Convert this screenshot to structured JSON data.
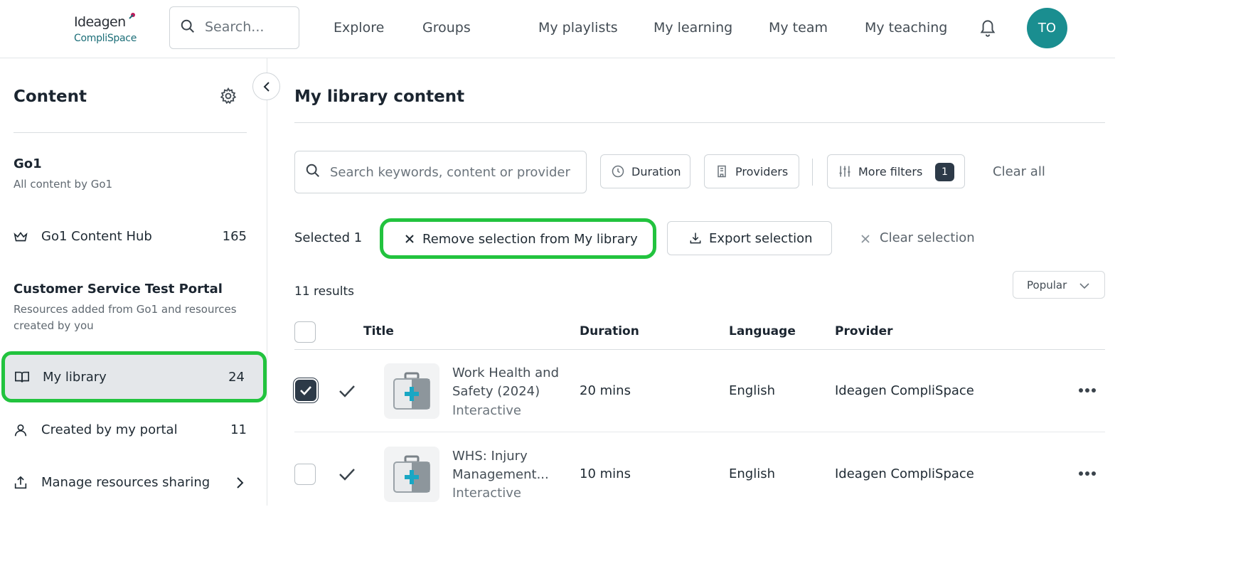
{
  "header": {
    "logo_line1": "Ideagen",
    "logo_line2": "CompliSpace",
    "search_placeholder": "Search...",
    "nav": [
      "Explore",
      "Groups",
      "My playlists",
      "My learning",
      "My team",
      "My teaching"
    ],
    "avatar_initials": "TO",
    "avatar_color": "#1a8e90"
  },
  "sidebar": {
    "title": "Content",
    "go1": {
      "title": "Go1",
      "subtitle": "All content by Go1"
    },
    "hub": {
      "label": "Go1 Content Hub",
      "count": "165"
    },
    "portal": {
      "title": "Customer Service Test Portal",
      "subtitle": "Resources added from Go1 and resources created by you"
    },
    "library": {
      "label": "My library",
      "count": "24"
    },
    "created": {
      "label": "Created by my portal",
      "count": "11"
    },
    "sharing": {
      "label": "Manage resources sharing"
    }
  },
  "main": {
    "title": "My library content",
    "search_placeholder": "Search keywords, content or provider",
    "filters": {
      "duration": "Duration",
      "providers": "Providers",
      "more": "More filters",
      "more_count": "1",
      "clear_all": "Clear all"
    },
    "selection": {
      "selected": "Selected 1",
      "remove": "Remove selection from My library",
      "export": "Export selection",
      "clear": "Clear selection"
    },
    "results": "11 results",
    "sort": "Popular",
    "columns": {
      "title": "Title",
      "duration": "Duration",
      "language": "Language",
      "provider": "Provider"
    },
    "rows": [
      {
        "title": "Work Health and Safety (2024)",
        "type": "Interactive",
        "duration": "20 mins",
        "language": "English",
        "provider": "Ideagen CompliSpace",
        "selected": true
      },
      {
        "title": "WHS: Injury Management...",
        "type": "Interactive",
        "duration": "10 mins",
        "language": "English",
        "provider": "Ideagen CompliSpace",
        "selected": false
      }
    ]
  },
  "colors": {
    "highlight": "#22c33e",
    "accent_dark": "#2d3a48",
    "teal": "#1a8e90"
  }
}
